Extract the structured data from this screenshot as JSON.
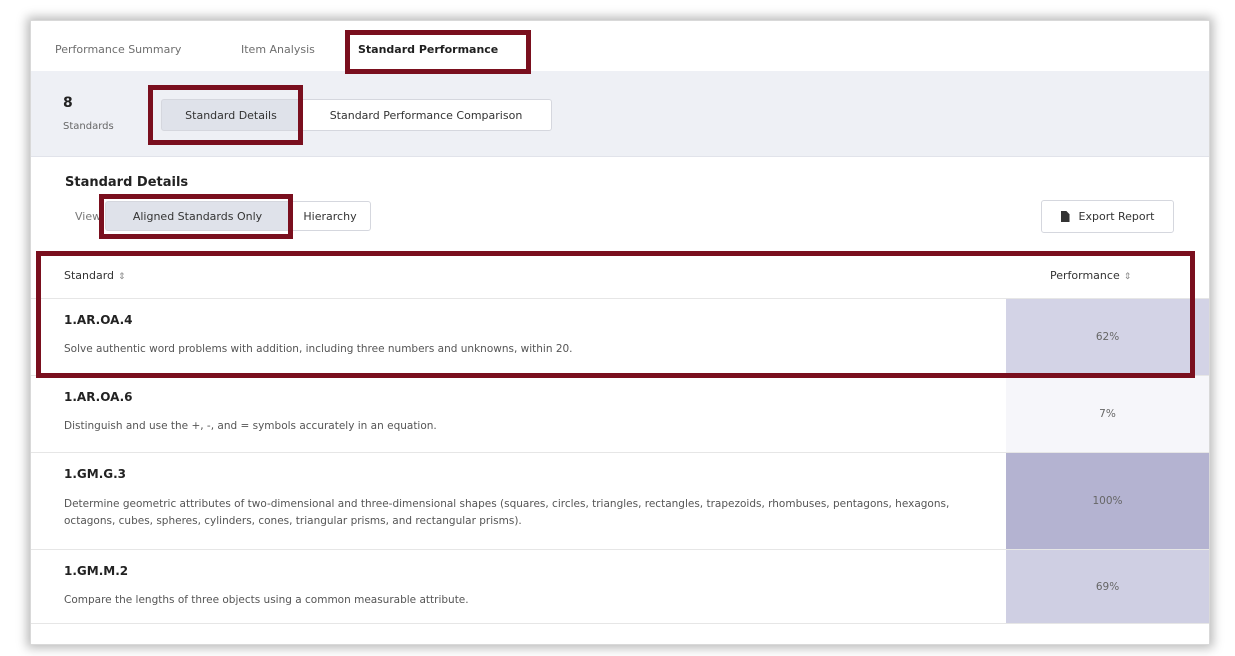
{
  "tabs": [
    {
      "label": "Performance Summary",
      "active": false
    },
    {
      "label": "Item Analysis",
      "active": false
    },
    {
      "label": "Standard Performance",
      "active": true
    }
  ],
  "summary": {
    "count": "8",
    "count_label": "Standards",
    "view_buttons": [
      "Standard Details",
      "Standard Performance Comparison"
    ],
    "selected_view": "Standard Details"
  },
  "details": {
    "title": "Standard Details",
    "view_label": "View:",
    "view_options": [
      "Aligned Standards Only",
      "Hierarchy"
    ],
    "selected_option": "Aligned Standards Only",
    "export_label": "Export Report",
    "export_icon": "file-icon"
  },
  "table": {
    "columns": [
      {
        "label": "Standard",
        "sort_icon": "⇕"
      },
      {
        "label": "Performance",
        "sort_icon": "⇕"
      }
    ],
    "rows": [
      {
        "code": "1.AR.OA.4",
        "description": "Solve authentic word problems with addition, including three numbers and unknowns, within 20.",
        "performance": "62%",
        "percent": 62,
        "color": "#d3d3e6"
      },
      {
        "code": "1.AR.OA.6",
        "description": "Distinguish and use the +, -, and = symbols accurately in an equation.",
        "performance": "7%",
        "percent": 7,
        "color": "#f6f6fa"
      },
      {
        "code": "1.GM.G.3",
        "description": "Determine geometric attributes of two-dimensional and three-dimensional shapes (squares, circles, triangles, rectangles, trapezoids, rhombuses, pentagons, hexagons, octagons, cubes, spheres, cylinders, cones, triangular prisms, and rectangular prisms).",
        "performance": "100%",
        "percent": 100,
        "color": "#b4b3d1"
      },
      {
        "code": "1.GM.M.2",
        "description": "Compare the lengths of three objects using a common measurable attribute.",
        "performance": "69%",
        "percent": 69,
        "color": "#cfcfe3"
      }
    ]
  },
  "colors": {
    "highlight": "#7a0f1e",
    "subbar_bg": "#eef0f5",
    "selected_btn": "#dfe2ea"
  }
}
